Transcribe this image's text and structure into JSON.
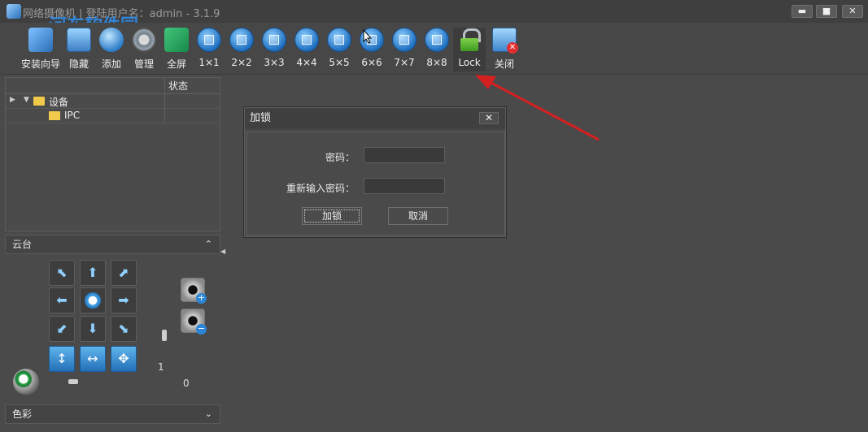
{
  "window": {
    "title": "网络摄像机 | 登陆用户名：admin - 3.1.9",
    "watermark": "河东软件园",
    "controls": {
      "minimize": "▬",
      "maximize": "■",
      "close": "✕"
    }
  },
  "toolbar": {
    "items": [
      {
        "label": "安装向导",
        "icon": "wizard-icon"
      },
      {
        "label": "隐藏",
        "icon": "hide-icon"
      },
      {
        "label": "添加",
        "icon": "add-icon"
      },
      {
        "label": "管理",
        "icon": "gear-icon"
      },
      {
        "label": "全屏",
        "icon": "fullscreen-icon"
      },
      {
        "label": "1×1",
        "icon": "grid-1x1-icon"
      },
      {
        "label": "2×2",
        "icon": "grid-2x2-icon"
      },
      {
        "label": "3×3",
        "icon": "grid-3x3-icon"
      },
      {
        "label": "4×4",
        "icon": "grid-4x4-icon"
      },
      {
        "label": "5×5",
        "icon": "grid-5x5-icon"
      },
      {
        "label": "6×6",
        "icon": "grid-6x6-icon"
      },
      {
        "label": "7×7",
        "icon": "grid-7x7-icon"
      },
      {
        "label": "8×8",
        "icon": "grid-8x8-icon"
      },
      {
        "label": "Lock",
        "icon": "lock-icon"
      },
      {
        "label": "关闭",
        "icon": "close-app-icon"
      }
    ]
  },
  "tree": {
    "status_header": "状态",
    "rows": [
      {
        "label": "设备"
      },
      {
        "label": "IPC"
      }
    ]
  },
  "ptz": {
    "title": "云台",
    "chevron": "⌃",
    "vertical_value": "1",
    "horizontal_value": "0"
  },
  "color_panel": {
    "title": "色彩",
    "chevron": "⌄"
  },
  "dialog": {
    "title": "加锁",
    "close": "✕",
    "password_label": "密码：",
    "password_value": "",
    "confirm_label": "重新输入密码：",
    "confirm_value": "",
    "ok_label": "加锁",
    "cancel_label": "取消"
  },
  "colors": {
    "accent": "#2f8ff0",
    "annotation_arrow": "#d42020"
  }
}
